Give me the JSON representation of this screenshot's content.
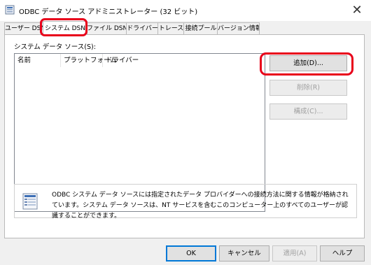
{
  "window": {
    "title": "ODBC データ ソース アドミニストレーター (32 ビット)",
    "close_glyph": "✕"
  },
  "tabs": [
    {
      "label": "ユーザー DSN",
      "active": false
    },
    {
      "label": "システム DSN",
      "active": true
    },
    {
      "label": "ファイル DSN",
      "active": false
    },
    {
      "label": "ドライバー",
      "active": false
    },
    {
      "label": "トレース",
      "active": false
    },
    {
      "label": "接続プール",
      "active": false
    },
    {
      "label": "バージョン情報",
      "active": false
    }
  ],
  "system_dsn": {
    "list_label": "システム データ ソース(S):",
    "columns": [
      "名前",
      "プラットフォーム",
      "ドライバー"
    ],
    "rows": []
  },
  "side_buttons": {
    "add": "追加(D)...",
    "remove": "削除(R)",
    "configure": "構成(C)..."
  },
  "info": {
    "text": "ODBC システム データ ソースには指定されたデータ プロバイダーへの接続方法に関する情報が格納されています。システム データ ソースは、NT サービスを含むこのコンピューター上のすべてのユーザーが認識することができます。",
    "icon": "database-list-icon"
  },
  "footer_buttons": {
    "ok": "OK",
    "cancel": "キャンセル",
    "apply": "適用(A)",
    "help": "ヘルプ"
  },
  "highlight_color": "#e8001a",
  "accent": "#0078d7"
}
